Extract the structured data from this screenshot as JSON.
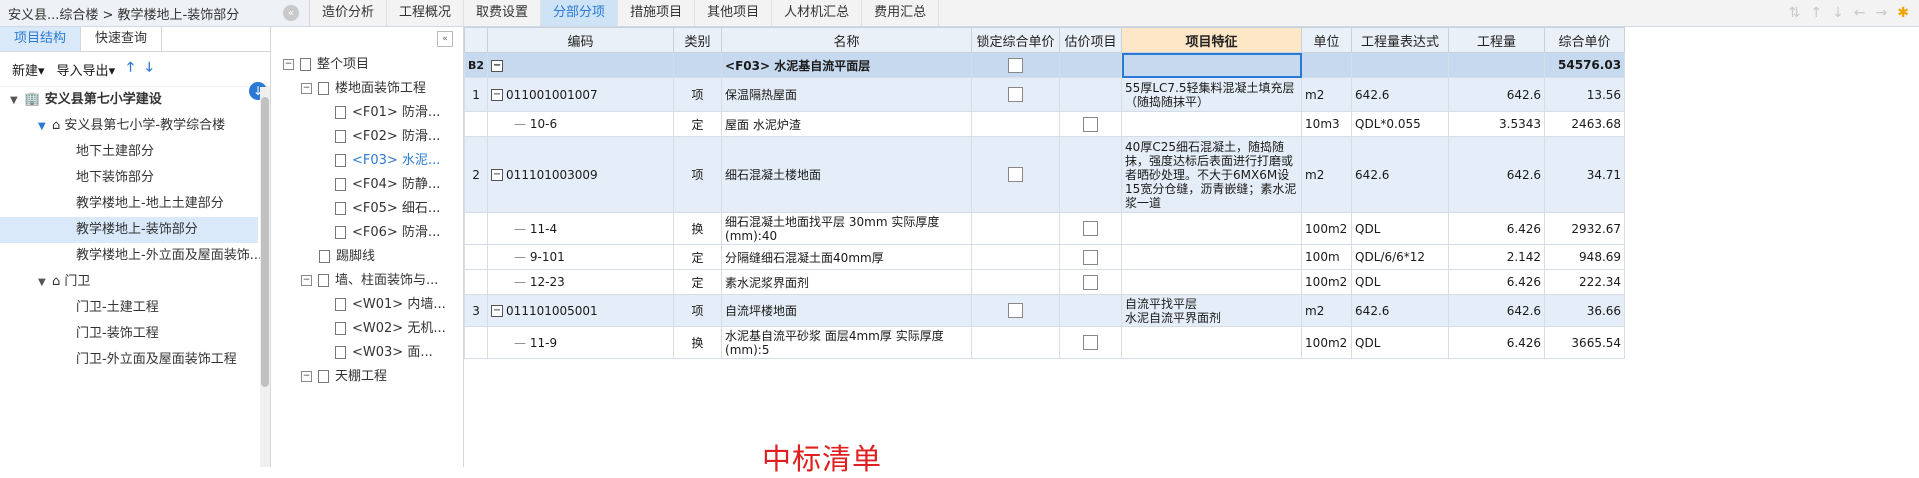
{
  "topbar": {
    "breadcrumb": "安义县...综合楼 > 教学楼地上-装饰部分",
    "tabs": [
      "造价分析",
      "工程概况",
      "取费设置",
      "分部分项",
      "措施项目",
      "其他项目",
      "人材机汇总",
      "费用汇总"
    ],
    "active_tab": "分部分项"
  },
  "left": {
    "subtabs": [
      "项目结构",
      "快速查询"
    ],
    "toolbar": {
      "new_label": "新建",
      "import_label": "导入导出"
    },
    "tree": [
      {
        "label": "安义县第七小学建设",
        "level": 0
      },
      {
        "label": "安义县第七小学-教学综合楼",
        "level": 1
      },
      {
        "label": "地下土建部分",
        "level": 2
      },
      {
        "label": "地下装饰部分",
        "level": 2
      },
      {
        "label": "教学楼地上-地上土建部分",
        "level": 2
      },
      {
        "label": "教学楼地上-装饰部分",
        "level": 2
      },
      {
        "label": "教学楼地上-外立面及屋面装饰...",
        "level": 2
      },
      {
        "label": "门卫",
        "level": 1
      },
      {
        "label": "门卫-土建工程",
        "level": 2
      },
      {
        "label": "门卫-装饰工程",
        "level": 2
      },
      {
        "label": "门卫-外立面及屋面装饰工程",
        "level": 2
      }
    ]
  },
  "middle": {
    "tree": [
      {
        "label": "整个项目",
        "type": "root"
      },
      {
        "label": "楼地面装饰工程",
        "type": "group"
      },
      {
        "label": "<F01> 防滑...",
        "type": "leaf"
      },
      {
        "label": "<F02> 防滑...",
        "type": "leaf"
      },
      {
        "label": "<F03> 水泥...",
        "type": "leaf"
      },
      {
        "label": "<F04> 防静...",
        "type": "leaf"
      },
      {
        "label": "<F05> 细石...",
        "type": "leaf"
      },
      {
        "label": "<F06> 防滑...",
        "type": "leaf"
      },
      {
        "label": "踢脚线",
        "type": "group2"
      },
      {
        "label": "墙、柱面装饰与...",
        "type": "group"
      },
      {
        "label": "<W01> 内墙...",
        "type": "leaf"
      },
      {
        "label": "<W02> 无机...",
        "type": "leaf"
      },
      {
        "label": "<W03> 面...",
        "type": "leaf"
      },
      {
        "label": "天棚工程",
        "type": "group"
      }
    ]
  },
  "table": {
    "headers": [
      "编码",
      "类别",
      "名称",
      "锁定综合单价",
      "估价项目",
      "项目特征",
      "单位",
      "工程量表达式",
      "工程量",
      "综合单价"
    ],
    "chapter": {
      "row": "B2",
      "name": "<F03> 水泥基自流平面层",
      "price": "54576.03"
    },
    "rows": [
      {
        "no": "1",
        "code": "011001001007",
        "type": "项",
        "name": "保温隔热屋面",
        "feature": "55厚LC7.5轻集料混凝土填充层（随捣随抹平）",
        "unit": "m2",
        "expr": "642.6",
        "qty": "642.6",
        "price": "13.56",
        "item": true
      },
      {
        "no": "",
        "code": "10-6",
        "type": "定",
        "name": "屋面 水泥炉渣",
        "feature": "",
        "unit": "10m3",
        "expr": "QDL*0.055",
        "qty": "3.5343",
        "price": "2463.68",
        "item": false
      },
      {
        "no": "2",
        "code": "011101003009",
        "type": "项",
        "name": "细石混凝土楼地面",
        "feature": "40厚C25细石混凝土，随捣随抹，强度达标后表面进行打磨或者晒砂处理。不大于6MX6M设15宽分仓缝，沥青嵌缝；素水泥浆一道",
        "unit": "m2",
        "expr": "642.6",
        "qty": "642.6",
        "price": "34.71",
        "item": true
      },
      {
        "no": "",
        "code": "11-4",
        "type": "换",
        "name": "细石混凝土地面找平层 30mm  实际厚度(mm):40",
        "feature": "",
        "unit": "100m2",
        "expr": "QDL",
        "qty": "6.426",
        "price": "2932.67",
        "item": false
      },
      {
        "no": "",
        "code": "9-101",
        "type": "定",
        "name": "分隔缝细石混凝土面40mm厚",
        "feature": "",
        "unit": "100m",
        "expr": "QDL/6/6*12",
        "qty": "2.142",
        "price": "948.69",
        "item": false
      },
      {
        "no": "",
        "code": "12-23",
        "type": "定",
        "name": "素水泥浆界面剂",
        "feature": "",
        "unit": "100m2",
        "expr": "QDL",
        "qty": "6.426",
        "price": "222.34",
        "item": false
      },
      {
        "no": "3",
        "code": "011101005001",
        "type": "项",
        "name": "自流坪楼地面",
        "feature": "自流平找平层\n水泥自流平界面剂",
        "unit": "m2",
        "expr": "642.6",
        "qty": "642.6",
        "price": "36.66",
        "item": true
      },
      {
        "no": "",
        "code": "11-9",
        "type": "换",
        "name": "水泥基自流平砂浆 面层4mm厚  实际厚度(mm):5",
        "feature": "",
        "unit": "100m2",
        "expr": "QDL",
        "qty": "6.426",
        "price": "3665.54",
        "item": false
      }
    ]
  },
  "caption": "中标清单"
}
